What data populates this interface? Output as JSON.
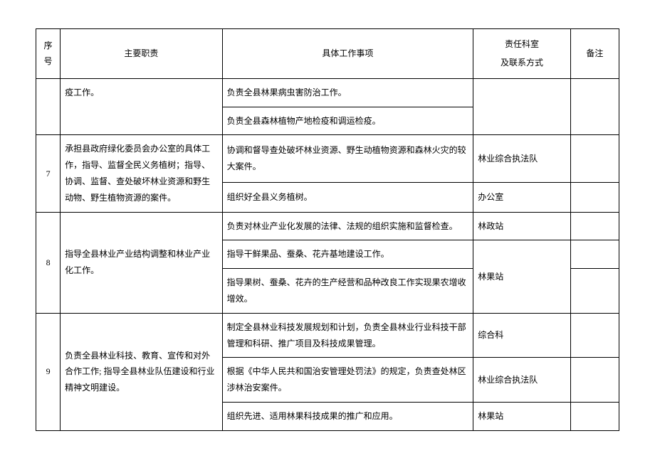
{
  "headers": {
    "seq": "序号",
    "duty": "主要职责",
    "item": "具体工作事项",
    "dept_line1": "责任科室",
    "dept_line2": "及联系方式",
    "note": "备注"
  },
  "rows": [
    {
      "seq": "",
      "duty": "疫工作。",
      "items": [
        {
          "text": "负责全县林果病虫害防治工作。",
          "dept": "",
          "dept_rowspan": 2
        },
        {
          "text": "负责全县森林植物产地检疫和调运检疫。",
          "dept": null
        }
      ]
    },
    {
      "seq": "7",
      "duty": "承担县政府绿化委员会办公室的具体工作，指导、监督全民义务植树；指导、协调、监督、查处破坏林业资源和野生动物、野生植物资源的案件。",
      "items": [
        {
          "text": "协调和督导查处破坏林业资源、野生动植物资源和森林火灾的较大案件。",
          "dept": "林业综合执法队"
        },
        {
          "text": "组织好全县义务植树。",
          "dept": "办公室"
        }
      ]
    },
    {
      "seq": "8",
      "duty": "指导全县林业产业结构调整和林业产业化工作。",
      "items": [
        {
          "text": "负责对林业产业化发展的法律、法规的组织实施和监督检查。",
          "dept": "林政站"
        },
        {
          "text": "指导干鲜果品、蚕桑、花卉基地建设工作。",
          "dept": "林果站",
          "dept_rowspan": 2
        },
        {
          "text": "指导果树、蚕桑、花卉的生产经营和品种改良工作实现果农增收增效。",
          "dept": null
        }
      ]
    },
    {
      "seq": "9",
      "duty": "负责全县林业科技、教育、宣传和对外合作工作; 指导全县林业队伍建设和行业精神文明建设。",
      "items": [
        {
          "text": "制定全县林业科技发展规划和计划，负责全县林业行业科技干部管理和科研、推广项目及科技成果管理。",
          "dept": "综合科"
        },
        {
          "text": "根据《中华人民共和国治安管理处罚法》的规定，负责查处林区涉林治安案件。",
          "dept": "林业综合执法队"
        },
        {
          "text": "组织先进、适用林果科技成果的推广和应用。",
          "dept": "林果站"
        }
      ]
    }
  ]
}
